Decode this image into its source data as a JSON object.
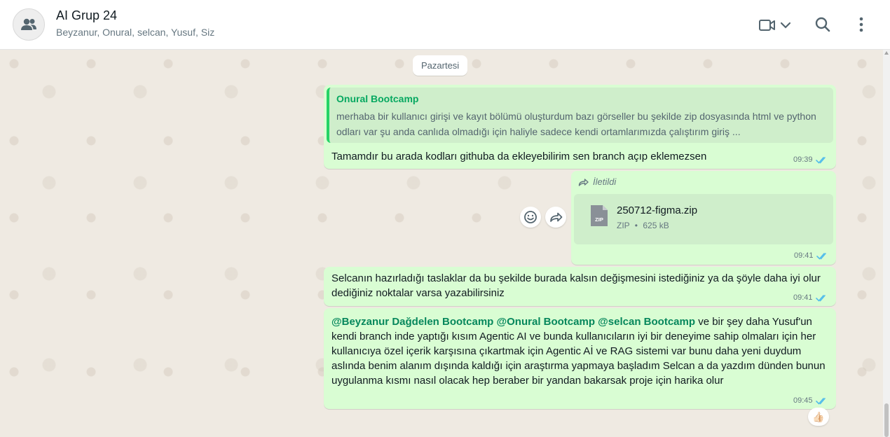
{
  "header": {
    "title": "AI Grup 24",
    "members": "Beyzanur, Onural, selcan, Yusuf, Siz"
  },
  "icons": {
    "avatar": "group-icon",
    "video": "video-call-icon",
    "dropdown": "chevron-down-icon",
    "search": "search-icon",
    "menu": "kebab-menu-icon",
    "double_check": "double-check-icon",
    "forward": "forward-icon",
    "emoji": "emoji-icon",
    "file": "zip-file-icon",
    "reaction": "thumbs-up-emoji"
  },
  "colors": {
    "outgoing_bubble": "#d9fdd3",
    "quote_accent": "#25d366",
    "mention": "#06875c",
    "tick_read": "#53bdeb"
  },
  "date_divider": "Pazartesi",
  "messages": [
    {
      "quote_author": "Onural Bootcamp",
      "quote_text": "merhaba bir kullanıcı girişi ve kayıt bölümü oluşturdum bazı görseller bu şekilde zip dosyasında html ve python odları var şu anda canlıda olmadığı için haliyle sadece kendi ortamlarımızda çalıştırım giriş ...",
      "text": "Tamamdır bu arada kodları githuba da ekleyebilirim sen branch açıp  eklemezsen",
      "time": "09:39"
    },
    {
      "forwarded_label": "İletildi",
      "file_type_badge": "ZIP",
      "file_name": "250712-figma.zip",
      "file_type": "ZIP",
      "file_size": "625 kB",
      "separator": "•",
      "time": "09:41"
    },
    {
      "text": "Selcanın hazırladığı taslaklar da bu şekilde burada kalsın değişmesini istediğiniz ya da şöyle daha iyi olur dediğiniz noktalar varsa yazabilirsiniz",
      "time": "09:41"
    },
    {
      "mentions": [
        "@Beyzanur Dağdelen Bootcamp",
        "@Onural Bootcamp",
        "@selcan Bootcamp"
      ],
      "text": "ve bir şey daha Yusuf'un kendi branch inde yaptığı kısım Agentic AI ve bunda kullanıcıların iyi bir deneyime sahip olmaları için her kullanıcıya özel içerik karşısına çıkartmak için Agentic Aİ ve RAG sistemi var bunu daha yeni duydum aslında benim alanım dışında kaldığı için araştırma yapmaya başladım Selcan a da yazdım dünden bunun uygulanma kısmı nasıl olacak hep beraber bir yandan bakarsak proje için harika olur",
      "time": "09:45",
      "reaction": "👍🏻"
    }
  ]
}
